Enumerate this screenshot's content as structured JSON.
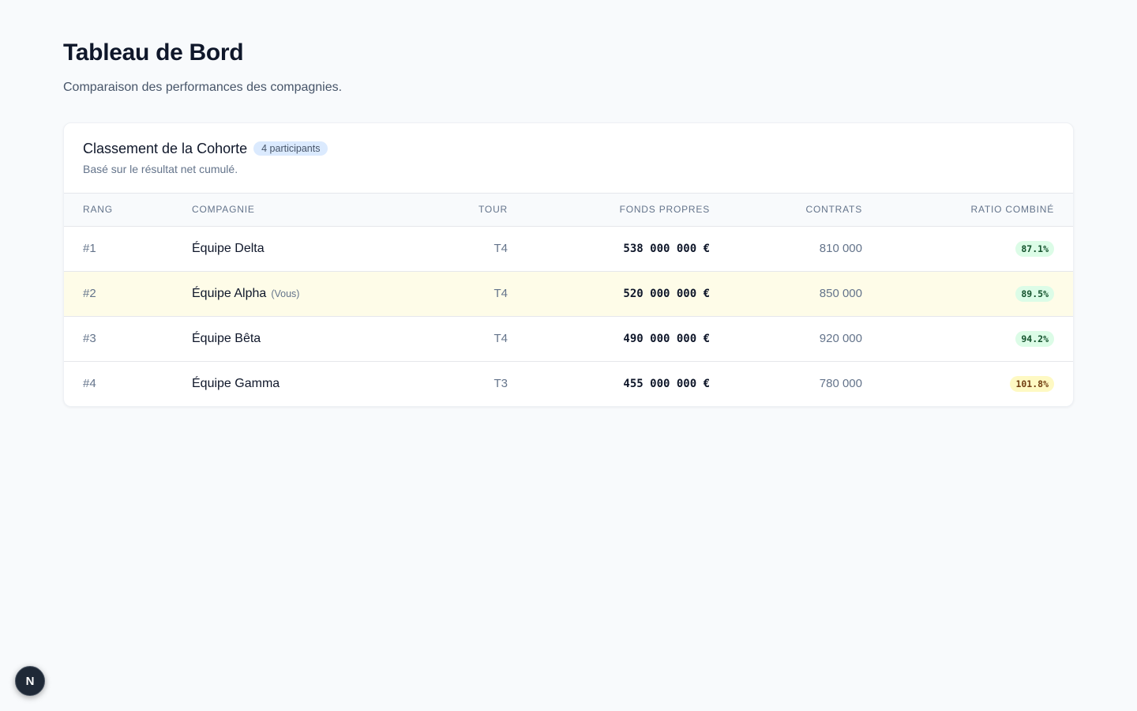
{
  "header": {
    "title": "Tableau de Bord",
    "subtitle": "Comparaison des performances des compagnies."
  },
  "leaderboard": {
    "title": "Classement de la Cohorte",
    "badge": "4 participants",
    "subtitle": "Basé sur le résultat net cumulé.",
    "columns": {
      "rank": "Rang",
      "company": "Compagnie",
      "tour": "Tour",
      "funds": "Fonds propres",
      "contracts": "Contrats",
      "ratio": "Ratio combiné"
    },
    "rows": [
      {
        "rank": "#1",
        "company": "Équipe Delta",
        "you": "",
        "tour": "T4",
        "funds": "538 000 000 €",
        "contracts": "810 000",
        "ratio": "87.1%",
        "ratio_status": "good"
      },
      {
        "rank": "#2",
        "company": "Équipe Alpha",
        "you": "(Vous)",
        "tour": "T4",
        "funds": "520 000 000 €",
        "contracts": "850 000",
        "ratio": "89.5%",
        "ratio_status": "good"
      },
      {
        "rank": "#3",
        "company": "Équipe Bêta",
        "you": "",
        "tour": "T4",
        "funds": "490 000 000 €",
        "contracts": "920 000",
        "ratio": "94.2%",
        "ratio_status": "good"
      },
      {
        "rank": "#4",
        "company": "Équipe Gamma",
        "you": "",
        "tour": "T3",
        "funds": "455 000 000 €",
        "contracts": "780 000",
        "ratio": "101.8%",
        "ratio_status": "warn"
      }
    ]
  },
  "dev_badge": {
    "label": "N",
    "icon": "nextjs-logo-icon"
  },
  "colors": {
    "background": "#f8fafc",
    "highlight_row": "#fefce8",
    "badge_bg": "#dbeafe",
    "ratio_good": "#dcfce7",
    "ratio_warn": "#fef9c3"
  }
}
